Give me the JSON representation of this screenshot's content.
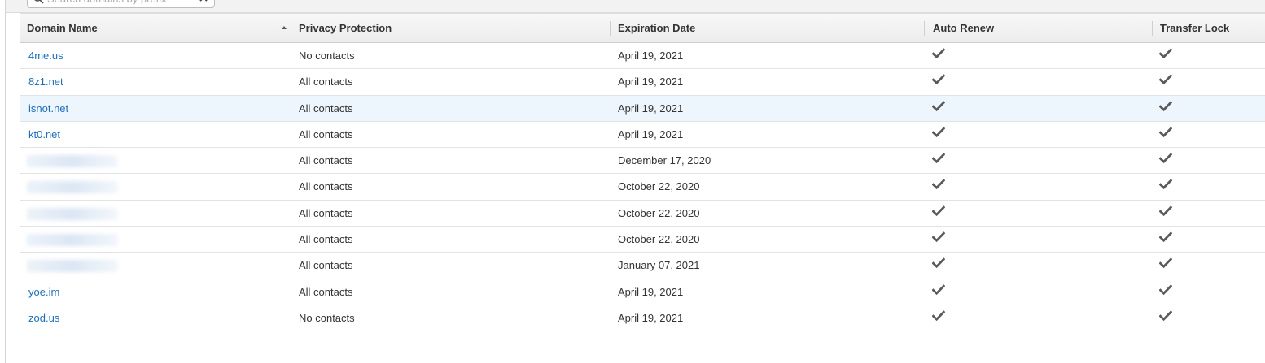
{
  "search": {
    "placeholder": "Search domains by prefix"
  },
  "table": {
    "columns": [
      "Domain Name",
      "Privacy Protection",
      "Expiration Date",
      "Auto Renew",
      "Transfer Lock"
    ],
    "sort": {
      "column": "Domain Name",
      "direction": "ascending"
    },
    "rows": [
      {
        "domain": "4me.us",
        "privacy": "No contacts",
        "expiration": "April 19, 2021",
        "auto_renew": true,
        "transfer_lock": true
      },
      {
        "domain": "8z1.net",
        "privacy": "All contacts",
        "expiration": "April 19, 2021",
        "auto_renew": true,
        "transfer_lock": true
      },
      {
        "domain": "isnot.net",
        "privacy": "All contacts",
        "expiration": "April 19, 2021",
        "auto_renew": true,
        "transfer_lock": true,
        "highlighted": true
      },
      {
        "domain": "kt0.net",
        "privacy": "All contacts",
        "expiration": "April 19, 2021",
        "auto_renew": true,
        "transfer_lock": true
      },
      {
        "domain": "",
        "blurred": true,
        "privacy": "All contacts",
        "expiration": "December 17, 2020",
        "auto_renew": true,
        "transfer_lock": true
      },
      {
        "domain": "",
        "blurred": true,
        "privacy": "All contacts",
        "expiration": "October 22, 2020",
        "auto_renew": true,
        "transfer_lock": true
      },
      {
        "domain": "",
        "blurred": true,
        "privacy": "All contacts",
        "expiration": "October 22, 2020",
        "auto_renew": true,
        "transfer_lock": true
      },
      {
        "domain": "",
        "blurred": true,
        "privacy": "All contacts",
        "expiration": "October 22, 2020",
        "auto_renew": true,
        "transfer_lock": true
      },
      {
        "domain": "",
        "blurred": true,
        "privacy": "All contacts",
        "expiration": "January 07, 2021",
        "auto_renew": true,
        "transfer_lock": true
      },
      {
        "domain": "yoe.im",
        "privacy": "All contacts",
        "expiration": "April 19, 2021",
        "auto_renew": true,
        "transfer_lock": true
      },
      {
        "domain": "zod.us",
        "privacy": "No contacts",
        "expiration": "April 19, 2021",
        "auto_renew": true,
        "transfer_lock": true
      }
    ]
  },
  "colors": {
    "link": "#1e6fba",
    "highlight_row": "#eef6fd",
    "checkmark": "#5a5a5a",
    "header_bg": "#f2f2f2"
  },
  "icons": {
    "search": "search-icon",
    "clear": "close-icon",
    "check": "checkmark-icon",
    "sort": "sort-ascending-icon"
  }
}
